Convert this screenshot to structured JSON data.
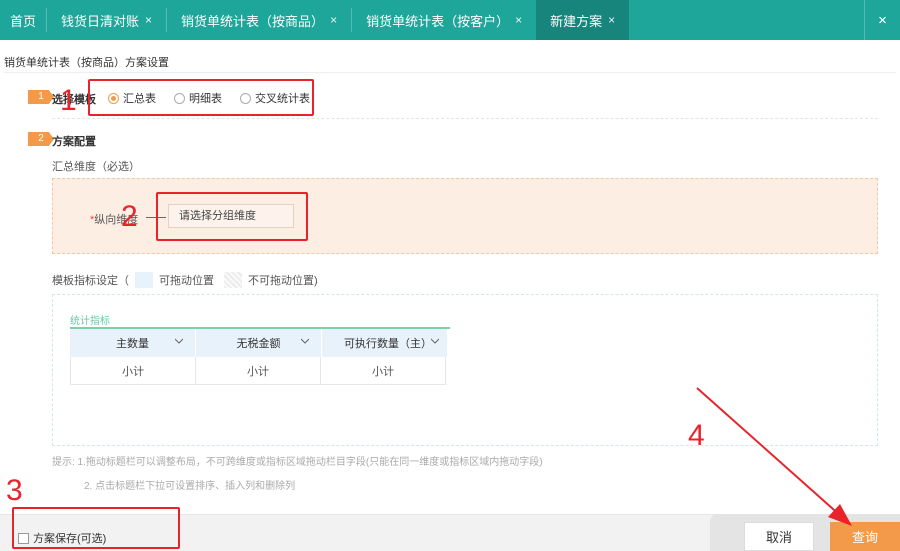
{
  "tabs": [
    {
      "label": "首页",
      "closable": false
    },
    {
      "label": "钱货日清对账",
      "closable": true
    },
    {
      "label": "销货单统计表（按商品）",
      "closable": true
    },
    {
      "label": "销货单统计表（按客户）",
      "closable": true
    },
    {
      "label": "新建方案",
      "closable": true,
      "active": true
    }
  ],
  "close_glyph": "×",
  "page_title": "销货单统计表（按商品）方案设置",
  "step1": {
    "badge": "1",
    "label": "选择模板",
    "options": [
      "汇总表",
      "明细表",
      "交叉统计表"
    ],
    "selected": "汇总表"
  },
  "step2": {
    "badge": "2",
    "label": "方案配置"
  },
  "summary_dim_label": "汇总维度（必选）",
  "vertical_dim": {
    "required_mark": "*",
    "label": "纵向维度",
    "placeholder": "请选择分组维度"
  },
  "legend": {
    "prefix": "模板指标设定（",
    "draggable": "可拖动位置",
    "not_draggable": "不可拖动位置)"
  },
  "metrics": {
    "title": "统计指标",
    "columns": [
      "主数量",
      "无税金额",
      "可执行数量（主）"
    ],
    "subtotals": [
      "小计",
      "小计",
      "小计"
    ]
  },
  "hints": {
    "line1": "提示:  1.拖动标题栏可以调整布局，不可跨维度或指标区域拖动栏目字段(只能在同一维度或指标区域内拖动字段)",
    "line2": "2. 点击标题栏下拉可设置排序、插入列和删除列"
  },
  "footer": {
    "save_label": "方案保存(可选)",
    "cancel_label": "取消",
    "query_label": "查询"
  },
  "annotations": [
    "1",
    "2",
    "3",
    "4"
  ],
  "colors": {
    "tab_bar": "#1fa69a",
    "accent": "#f39a4a",
    "annotation": "#e8232a"
  },
  "icons": {
    "close": "close-icon",
    "chevron": "chevron-down-icon"
  }
}
